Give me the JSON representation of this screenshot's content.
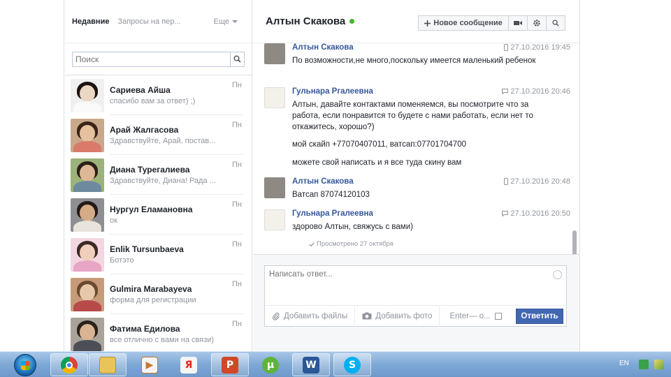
{
  "sidebar": {
    "tabs": {
      "recent": "Недавние",
      "requests": "Запросы на пер...",
      "more": "Еще"
    },
    "search": {
      "placeholder": "Поиск"
    },
    "conversations": [
      {
        "name": "Сариева Айша",
        "snippet": "спасибо вам за ответ) ;)",
        "day": "Пн"
      },
      {
        "name": "Арай Жалгасова",
        "snippet": "Здравствуйте, Арай, постав...",
        "day": "Пн"
      },
      {
        "name": "Диана Турегалиева",
        "snippet": "Здравствуйте, Диана! Рада ...",
        "day": "Пн"
      },
      {
        "name": "Нургул Еламановна",
        "snippet": "ок",
        "day": "Пн"
      },
      {
        "name": "Enlik Tursunbaeva",
        "snippet": "Ботэто",
        "day": "Пн"
      },
      {
        "name": "Gulmira Marabayeva",
        "snippet": "форма для регистрации",
        "day": "Пн"
      },
      {
        "name": "Фатима Едилова",
        "snippet": "все отлично с вами на связи)",
        "day": "Пн"
      }
    ]
  },
  "chat": {
    "title": "Алтын Скакова",
    "buttons": {
      "new_message": "Новое сообщение"
    },
    "messages": [
      {
        "name": "Алтын Скакова",
        "time": "27.10.2016 19:45",
        "lines": [
          "По возможности,не много,поскольку имеется маленький ребенок"
        ]
      },
      {
        "name": "Гульнара Ргалеевна",
        "time": "27.10.2016 20:46",
        "lines": [
          "Алтын, давайте контактами поменяемся, вы посмотрите что за работа, если понравится то будете с нами работать, если нет то откажитесь, хорошо?)",
          "мой скайп +77070407011, ватсап:07701704700",
          "можете свой написать и я все туда скину вам"
        ]
      },
      {
        "name": "Алтын Скакова",
        "time": "27.10.2016 20:48",
        "lines": [
          "Ватсап 87074120103"
        ]
      },
      {
        "name": "Гульнара Ргалеевна",
        "time": "27.10.2016 20:50",
        "lines": [
          "здорово Алтын, свяжусь с вами)"
        ]
      }
    ],
    "seen": "Просмотрено 27 октября"
  },
  "composer": {
    "placeholder": "Написать ответ...",
    "add_files": "Добавить файлы",
    "add_photo": "Добавить фото",
    "enter_option": "Enter— о...",
    "send": "Ответить"
  },
  "taskbar": {
    "lang": "EN"
  },
  "colors": {
    "link": "#365899",
    "accent": "#4267b2",
    "online": "#42b72a"
  }
}
